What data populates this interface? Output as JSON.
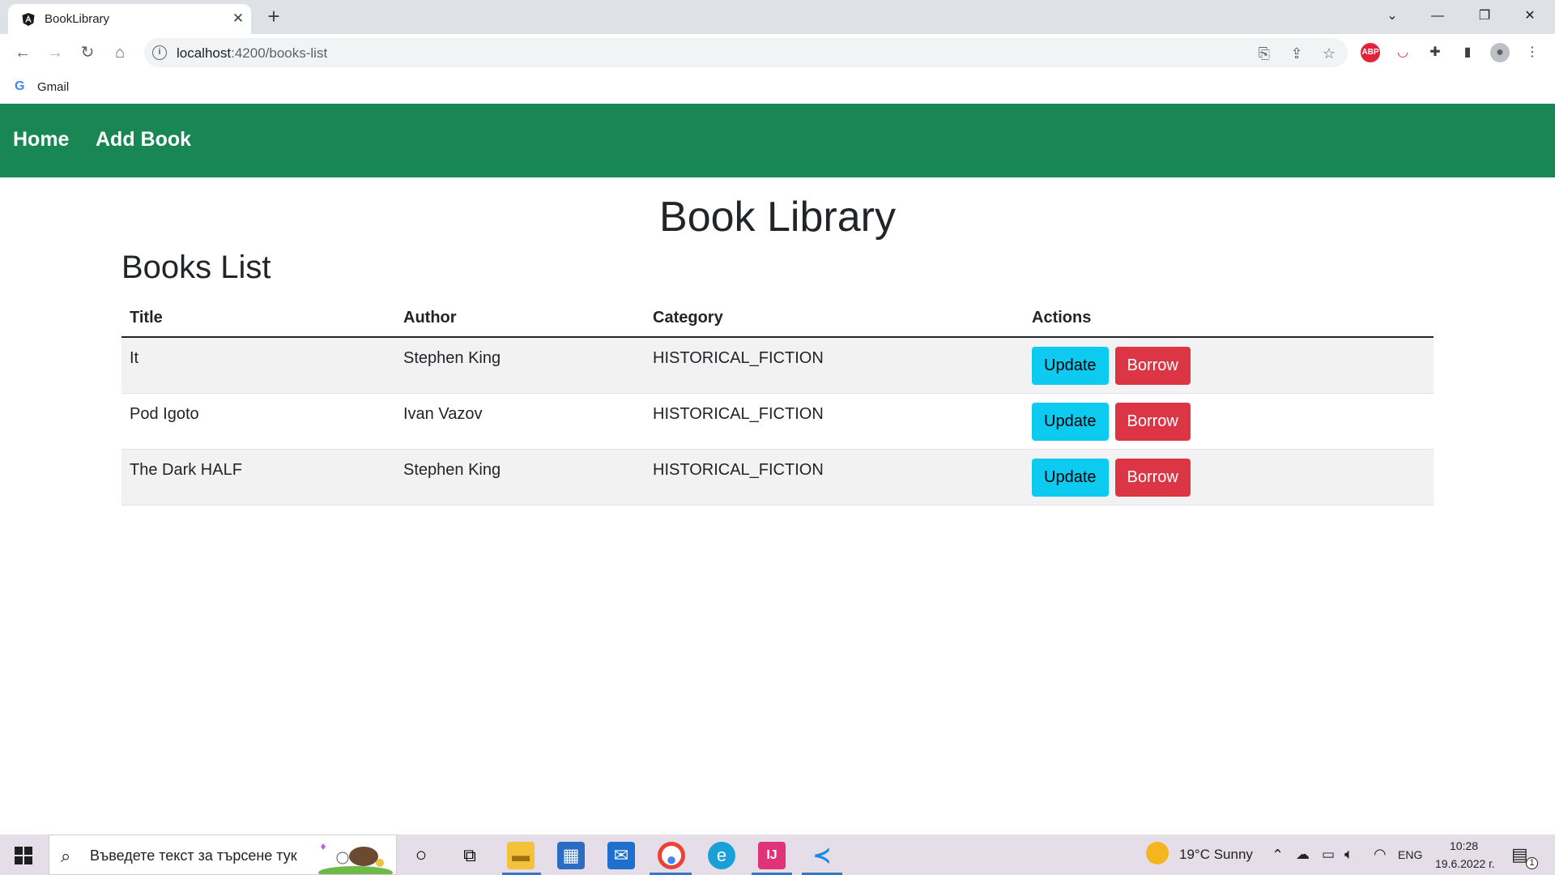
{
  "browser": {
    "tab_title": "BookLibrary",
    "tab_close": "✕",
    "new_tab": "+",
    "url_host": "localhost",
    "url_path": ":4200/books-list",
    "bookmark_gmail": "Gmail",
    "window_controls": [
      "⌄",
      "—",
      "❐",
      "✕"
    ]
  },
  "app": {
    "nav": {
      "home": "Home",
      "add_book": "Add Book"
    },
    "page_title": "Book Library",
    "section_title": "Books List",
    "table": {
      "headers": [
        "Title",
        "Author",
        "Category",
        "Actions"
      ],
      "rows": [
        {
          "title": "It",
          "author": "Stephen King",
          "category": "HISTORICAL_FICTION"
        },
        {
          "title": "Pod Igoto",
          "author": "Ivan Vazov",
          "category": "HISTORICAL_FICTION"
        },
        {
          "title": "The Dark HALF",
          "author": "Stephen King",
          "category": "HISTORICAL_FICTION"
        }
      ],
      "update_label": "Update",
      "borrow_label": "Borrow"
    },
    "colors": {
      "navbar": "#198754",
      "update_button": "#0dcaf0",
      "borrow_button": "#dc3545"
    }
  },
  "taskbar": {
    "search_placeholder": "Въведете текст за търсене тук",
    "weather": "19°C  Sunny",
    "language": "ENG",
    "time": "10:28",
    "date": "19.6.2022 г.",
    "notifications_count": "1"
  }
}
